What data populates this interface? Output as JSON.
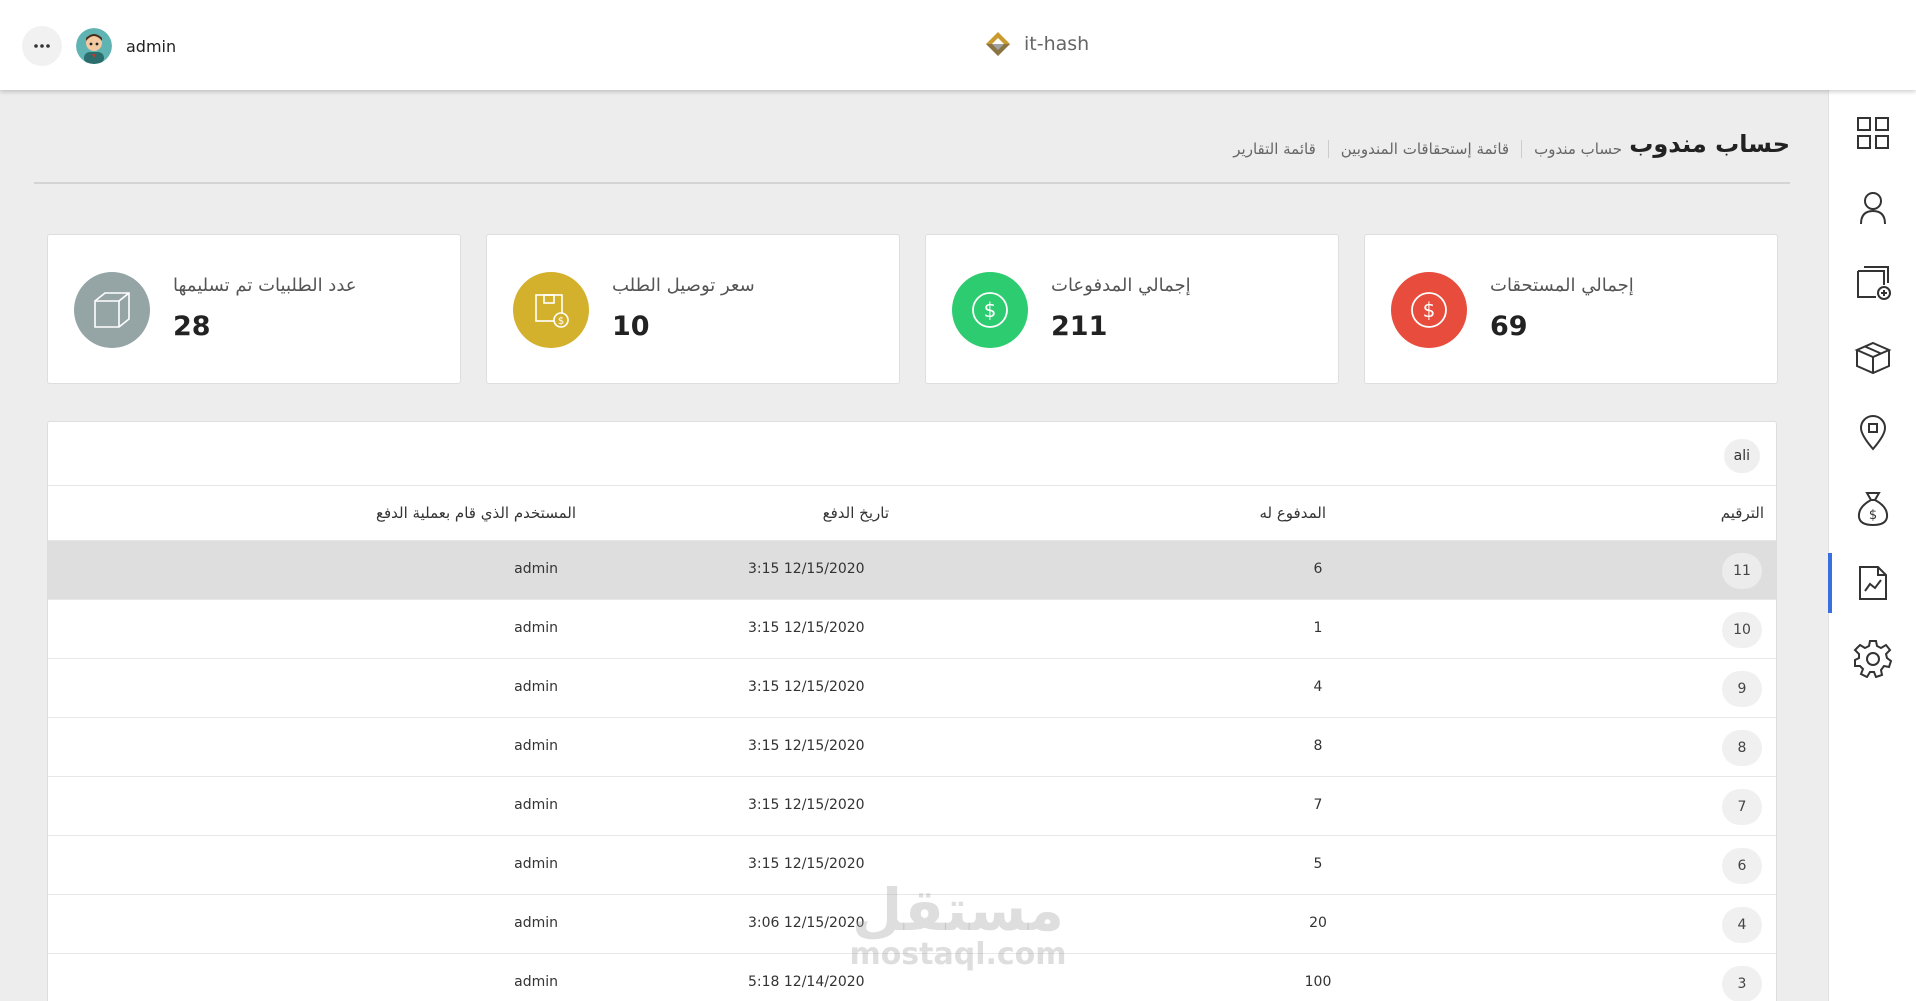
{
  "topbar": {
    "user_name": "admin",
    "brand_name": "it-hash"
  },
  "sidebar": {
    "items": [
      {
        "icon": "dashboard-grid-icon"
      },
      {
        "icon": "user-icon"
      },
      {
        "icon": "add-document-icon"
      },
      {
        "icon": "package-box-icon"
      },
      {
        "icon": "location-pin-icon"
      },
      {
        "icon": "money-bag-icon"
      },
      {
        "icon": "report-chart-icon",
        "active": true
      },
      {
        "icon": "settings-gear-icon"
      }
    ]
  },
  "header": {
    "page_title": "حساب مندوب",
    "breadcrumb": [
      "قائمة التقارير",
      "قائمة إستحقاقات المندوبين",
      "حساب مندوب"
    ]
  },
  "cards": [
    {
      "label": "إجمالي المستحقات",
      "value": "69",
      "color": "#e74c3c",
      "icon": "dollar-circle-icon"
    },
    {
      "label": "إجمالي المدفوعات",
      "value": "211",
      "color": "#2ecc71",
      "icon": "dollar-circle-icon"
    },
    {
      "label": "سعر توصيل الطلب",
      "value": "10",
      "color": "#d4b12c",
      "icon": "delivery-box-icon"
    },
    {
      "label": "عدد الطلبيات تم تسليمها",
      "value": "28",
      "color": "#95a5a6",
      "icon": "cube-icon"
    }
  ],
  "table": {
    "filter_tag": "ali",
    "columns": {
      "number": "الترقيم",
      "paid_to": "المدفوع له",
      "payment_date": "تاريخ الدفع",
      "paid_by": "المستخدم الذي قام بعملية الدفع"
    },
    "rows": [
      {
        "number": "11",
        "paid_to": "6",
        "payment_date": "3:15 12/15/2020",
        "paid_by": "admin"
      },
      {
        "number": "10",
        "paid_to": "1",
        "payment_date": "3:15 12/15/2020",
        "paid_by": "admin"
      },
      {
        "number": "9",
        "paid_to": "4",
        "payment_date": "3:15 12/15/2020",
        "paid_by": "admin"
      },
      {
        "number": "8",
        "paid_to": "8",
        "payment_date": "3:15 12/15/2020",
        "paid_by": "admin"
      },
      {
        "number": "7",
        "paid_to": "7",
        "payment_date": "3:15 12/15/2020",
        "paid_by": "admin"
      },
      {
        "number": "6",
        "paid_to": "5",
        "payment_date": "3:15 12/15/2020",
        "paid_by": "admin"
      },
      {
        "number": "4",
        "paid_to": "20",
        "payment_date": "3:06 12/15/2020",
        "paid_by": "admin"
      },
      {
        "number": "3",
        "paid_to": "100",
        "payment_date": "5:18 12/14/2020",
        "paid_by": "admin"
      }
    ]
  },
  "watermark": {
    "arabic": "مستقل",
    "latin": "mostaql.com"
  }
}
